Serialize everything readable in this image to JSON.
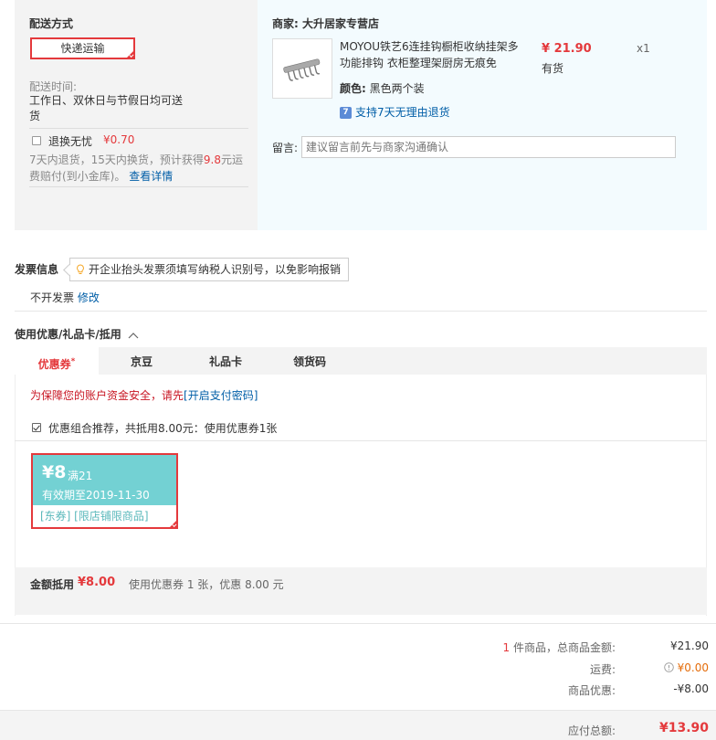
{
  "shipping": {
    "heading": "配送方式",
    "method": "快递运输",
    "time_label": "配送时间:",
    "time_value": "工作日、双休日与节假日均可送货",
    "swap_label": "退换无忧",
    "swap_price": "¥0.70",
    "swap_desc_1": "7天内退货，15天内换货，预计获得",
    "swap_desc_highlight": "9.8",
    "swap_desc_2": "元运费赔付(到小金库)。",
    "swap_details_link": "查看详情"
  },
  "shop": {
    "merchant_label": "商家:",
    "merchant_name": "大升居家专营店",
    "product_title": "MOYOU铁艺6连挂钩橱柜收纳挂架多功能排钩 衣柜整理架厨房无痕免",
    "price": "¥ 21.90",
    "stock": "有货",
    "quantity": "x1",
    "color_label": "颜色:",
    "color_value": "黑色两个装",
    "return_icon_text": "7",
    "return_policy": "支持7天无理由退货",
    "memo_label": "留言:",
    "memo_placeholder": "建议留言前先与商家沟通确认"
  },
  "invoice": {
    "heading": "发票信息",
    "tip": "开企业抬头发票须填写纳税人识别号，以免影响报销",
    "status": "不开发票",
    "modify_link": "修改"
  },
  "coupons": {
    "heading": "使用优惠/礼品卡/抵用",
    "tabs": [
      "优惠券",
      "京豆",
      "礼品卡",
      "领货码"
    ],
    "tab_marker": "*",
    "security_warning": "为保障您的账户资金安全，请先",
    "security_link": "[开启支付密码]",
    "combo_text": "优惠组合推荐，共抵用8.00元：使用优惠券1张",
    "card": {
      "amount": "¥8",
      "condition": "满21",
      "validity": "有效期至2019-11-30",
      "tags": "[东券]  [限店铺限商品]"
    },
    "summary_label": "金额抵用",
    "summary_amount": "¥8.00",
    "summary_desc": "使用优惠券 1 张，优惠 8.00 元"
  },
  "totals": {
    "count": "1",
    "count_label": "件商品，总商品金额:",
    "goods_amount": "¥21.90",
    "freight_label": "运费:",
    "freight_value": "¥0.00",
    "discount_label": "商品优惠:",
    "discount_value": "-¥8.00",
    "payable_label": "应付总额:",
    "payable_value": "¥13.90"
  },
  "colors": {
    "accent": "#e4393c",
    "coupon": "#73d1d3",
    "link": "#005ea7"
  }
}
